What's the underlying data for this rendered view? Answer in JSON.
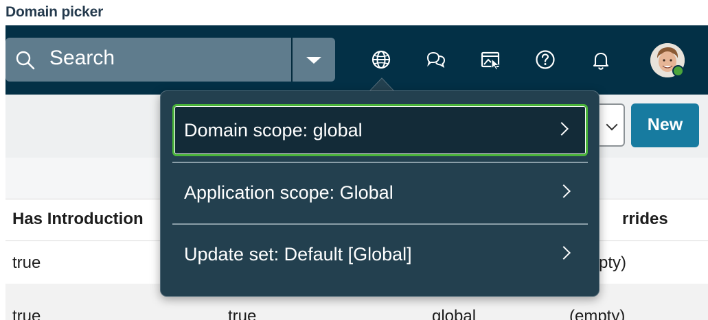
{
  "page": {
    "heading": "Domain picker"
  },
  "topbar": {
    "search_label": "Search",
    "icons": [
      "search-icon",
      "caret-down-icon",
      "globe-icon",
      "chat-icon",
      "screen-cursor-icon",
      "help-icon",
      "bell-icon"
    ],
    "avatar_status": "online"
  },
  "toolbar": {
    "new_label": "New"
  },
  "table": {
    "headers": [
      "Has Introduction",
      "Has Overrides"
    ],
    "header_visible_fragment": "rrides",
    "rows": [
      {
        "col1": "true",
        "col4": "pty)"
      },
      {
        "col1": "true",
        "col2": "true",
        "col3": "global",
        "col4": "(empty)"
      }
    ]
  },
  "picker": {
    "items": [
      {
        "label": "Domain scope: global",
        "selected": true
      },
      {
        "label": "Application scope: Global",
        "selected": false
      },
      {
        "label": "Update set: Default [Global]",
        "selected": false
      }
    ]
  },
  "colors": {
    "topbar": "#033046",
    "popover": "#23404f",
    "focus_ring": "#4ab43a",
    "new_button": "#177ba0"
  }
}
